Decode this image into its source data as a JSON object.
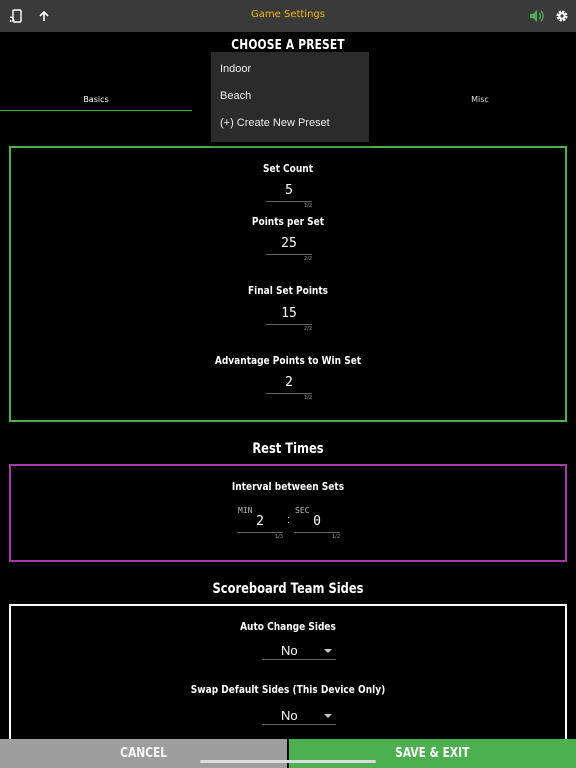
{
  "header": {
    "title": "Game Settings",
    "title_color": "#f2b705",
    "icons": [
      "cast-icon",
      "share-arrow-up-icon",
      "speaker-icon",
      "gear-icon"
    ]
  },
  "preset": {
    "title": "CHOOSE A PRESET",
    "options": [
      "Indoor",
      "Beach",
      "(+) Create New Preset"
    ]
  },
  "tabs": {
    "basics": "Basics",
    "misc": "Misc"
  },
  "basics": {
    "set_count": {
      "label": "Set Count",
      "value": "5",
      "count": "1/2"
    },
    "points_per_set": {
      "label": "Points per Set",
      "value": "25",
      "count": "2/2"
    },
    "final_set_points": {
      "label": "Final Set Points",
      "value": "15",
      "count": "2/2"
    },
    "advantage_points": {
      "label": "Advantage Points to Win Set",
      "value": "2",
      "count": "1/2"
    }
  },
  "rest_times": {
    "title": "Rest Times",
    "interval_label": "Interval between Sets",
    "min_label": "MIN",
    "min_value": "2",
    "min_count": "1/3",
    "separator": ":",
    "sec_label": "SEC",
    "sec_value": "0",
    "sec_count": "1/2"
  },
  "team_sides": {
    "title": "Scoreboard Team Sides",
    "auto_change_label": "Auto Change Sides",
    "auto_change_value": "No",
    "swap_label": "Swap Default Sides (This Device Only)",
    "swap_value": "No"
  },
  "footer": {
    "cancel": "CANCEL",
    "save": "SAVE & EXIT"
  },
  "colors": {
    "green": "#4caf50",
    "purple": "#a23aa8",
    "accent": "#f2b705"
  }
}
